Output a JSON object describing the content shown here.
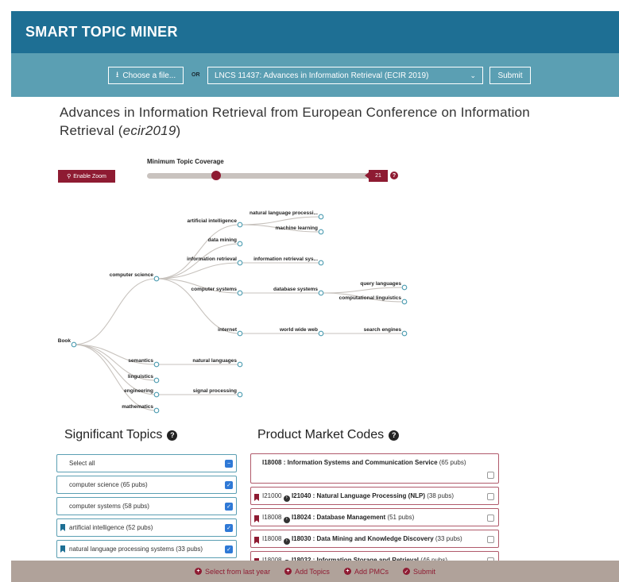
{
  "header": {
    "brand": "SMART TOPIC MINER"
  },
  "controls": {
    "choose_label": "Choose a file...",
    "or_label": "OR",
    "selected_volume": "LNCS 11437: Advances in Information Retrieval (ECIR 2019)",
    "submit_label": "Submit"
  },
  "page": {
    "title_main": "Advances in Information Retrieval from European Conference on Information Retrieval (",
    "title_code": "ecir2019",
    "title_close": ")"
  },
  "zoom": {
    "label": "Enable Zoom"
  },
  "coverage": {
    "label": "Minimum Topic Coverage",
    "value": "21",
    "min": 0,
    "max": 65
  },
  "tree": {
    "nodes": [
      {
        "id": "book",
        "label": "Book"
      },
      {
        "id": "cs",
        "label": "computer science"
      },
      {
        "id": "ai",
        "label": "artificial intelligence"
      },
      {
        "id": "nlp",
        "label": "natural language processi..."
      },
      {
        "id": "ml",
        "label": "machine learning"
      },
      {
        "id": "dm",
        "label": "data mining"
      },
      {
        "id": "ir",
        "label": "information retrieval"
      },
      {
        "id": "irs",
        "label": "information retrieval sys..."
      },
      {
        "id": "csys",
        "label": "computer systems"
      },
      {
        "id": "db",
        "label": "database systems"
      },
      {
        "id": "ql",
        "label": "query languages"
      },
      {
        "id": "cl",
        "label": "computational linguistics"
      },
      {
        "id": "inet",
        "label": "internet"
      },
      {
        "id": "www",
        "label": "world wide web"
      },
      {
        "id": "se",
        "label": "search engines"
      },
      {
        "id": "sem",
        "label": "semantics"
      },
      {
        "id": "nl",
        "label": "natural languages"
      },
      {
        "id": "ling",
        "label": "linguistics"
      },
      {
        "id": "eng",
        "label": "engineering"
      },
      {
        "id": "sp",
        "label": "signal processing"
      },
      {
        "id": "math",
        "label": "mathematics"
      }
    ]
  },
  "significant_topics": {
    "title": "Significant Topics",
    "items": [
      {
        "label": "Select all",
        "bookmark": false
      },
      {
        "label": "computer science (65 pubs)",
        "bookmark": false
      },
      {
        "label": "computer systems (58 pubs)",
        "bookmark": false
      },
      {
        "label": "artificial intelligence (52 pubs)",
        "bookmark": true
      },
      {
        "label": "natural language processing systems (33 pubs)",
        "bookmark": true
      }
    ]
  },
  "pmc": {
    "title": "Product Market Codes",
    "items": [
      {
        "pre": "",
        "bold": "I18008 : Information Systems and Communication Service",
        "post": " (65 pubs)",
        "bookmark": false
      },
      {
        "pre": "I21000",
        "bold": "I21040 : Natural Language Processing (NLP)",
        "post": " (38 pubs)",
        "bookmark": true
      },
      {
        "pre": "I18008",
        "bold": "I18024 : Database Management",
        "post": " (51 pubs)",
        "bookmark": true
      },
      {
        "pre": "I18008",
        "bold": "I18030 : Data Mining and Knowledge Discovery",
        "post": " (33 pubs)",
        "bookmark": true
      },
      {
        "pre": "I18008",
        "bold": "I18032 : Information Storage and Retrieval",
        "post": " (46 pubs)",
        "bookmark": true
      }
    ]
  },
  "footer": {
    "select_last_year": "Select from last year",
    "add_topics": "Add Topics",
    "add_pmcs": "Add PMCs",
    "submit": "Submit"
  }
}
